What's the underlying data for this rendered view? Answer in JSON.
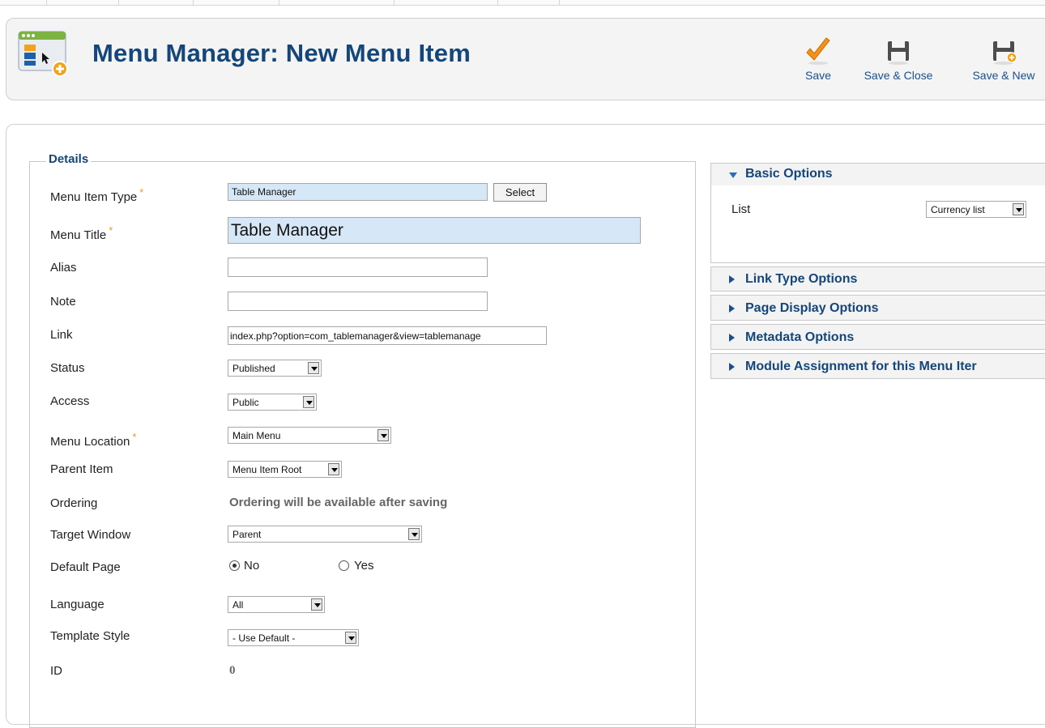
{
  "header": {
    "title": "Menu Manager: New Menu Item"
  },
  "toolbar": {
    "buttons": [
      {
        "label": "Save",
        "icon": "checkmark-icon"
      },
      {
        "label": "Save & Close",
        "icon": "floppy-disk-icon"
      },
      {
        "label": "Save & New",
        "icon": "floppy-disk-add-icon"
      }
    ]
  },
  "details": {
    "legend": "Details",
    "fields": {
      "menu_item_type": {
        "label": "Menu Item Type",
        "value": "Table Manager",
        "button": "Select",
        "required": "*"
      },
      "menu_title": {
        "label": "Menu Title",
        "value": "Table Manager",
        "required": "*"
      },
      "alias": {
        "label": "Alias",
        "value": ""
      },
      "note": {
        "label": "Note",
        "value": ""
      },
      "link": {
        "label": "Link",
        "value": "index.php?option=com_tablemanager&view=tablemanage"
      },
      "status": {
        "label": "Status",
        "value": "Published"
      },
      "access": {
        "label": "Access",
        "value": "Public"
      },
      "menu_location": {
        "label": "Menu Location",
        "value": "Main Menu",
        "required": "*"
      },
      "parent_item": {
        "label": "Parent Item",
        "value": "Menu Item Root"
      },
      "ordering": {
        "label": "Ordering",
        "value": "Ordering will be available after saving"
      },
      "target_window": {
        "label": "Target Window",
        "value": "Parent"
      },
      "default_page": {
        "label": "Default Page",
        "options": [
          "No",
          "Yes"
        ],
        "selected": "No"
      },
      "language": {
        "label": "Language",
        "value": "All"
      },
      "template_style": {
        "label": "Template Style",
        "value": "- Use Default -"
      },
      "id": {
        "label": "ID",
        "value": "0"
      }
    }
  },
  "panels": {
    "basic_options": {
      "title": "Basic Options",
      "expanded": true,
      "list_label": "List",
      "list_value": "Currency list"
    },
    "collapsed": [
      {
        "title": "Link Type Options"
      },
      {
        "title": "Page Display Options"
      },
      {
        "title": "Metadata Options"
      },
      {
        "title": "Module Assignment for this Menu Iter"
      }
    ]
  },
  "colors": {
    "title_blue": "#14467a",
    "required_orange": "#f09a1a",
    "input_highlight": "#d6e8f7",
    "panel_header_bg": "#f3f3f3"
  }
}
